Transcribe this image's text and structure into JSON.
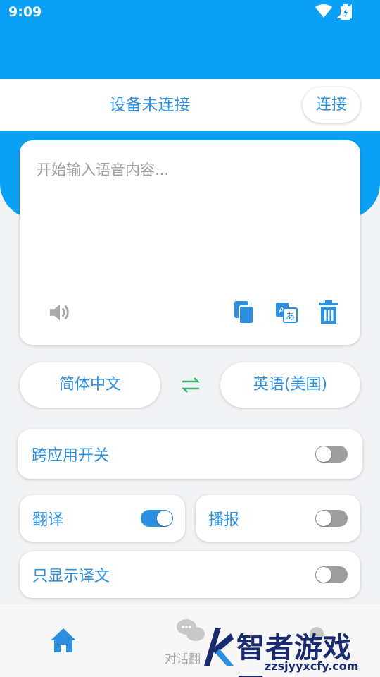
{
  "status_bar": {
    "time": "9:09"
  },
  "connection": {
    "status_text": "设备未连接",
    "connect_button": "连接"
  },
  "input": {
    "placeholder": "开始输入语音内容..."
  },
  "languages": {
    "source": "简体中文",
    "target": "英语(美国)"
  },
  "toggles": {
    "cross_app": {
      "label": "跨应用开关",
      "on": false
    },
    "translate": {
      "label": "翻译",
      "on": true
    },
    "broadcast": {
      "label": "播报",
      "on": false
    },
    "show_only_translation": {
      "label": "只显示译文",
      "on": false
    }
  },
  "bottom_nav": {
    "conversation_label": "对话翻"
  },
  "watermark": {
    "title": "智者游戏网",
    "url": "zzsjyyxcfy.com"
  },
  "colors": {
    "primary": "#0aa0f5",
    "text_blue": "#2d8fe0",
    "swap_green": "#3cb371",
    "toggle_off": "#9e9e9e"
  }
}
